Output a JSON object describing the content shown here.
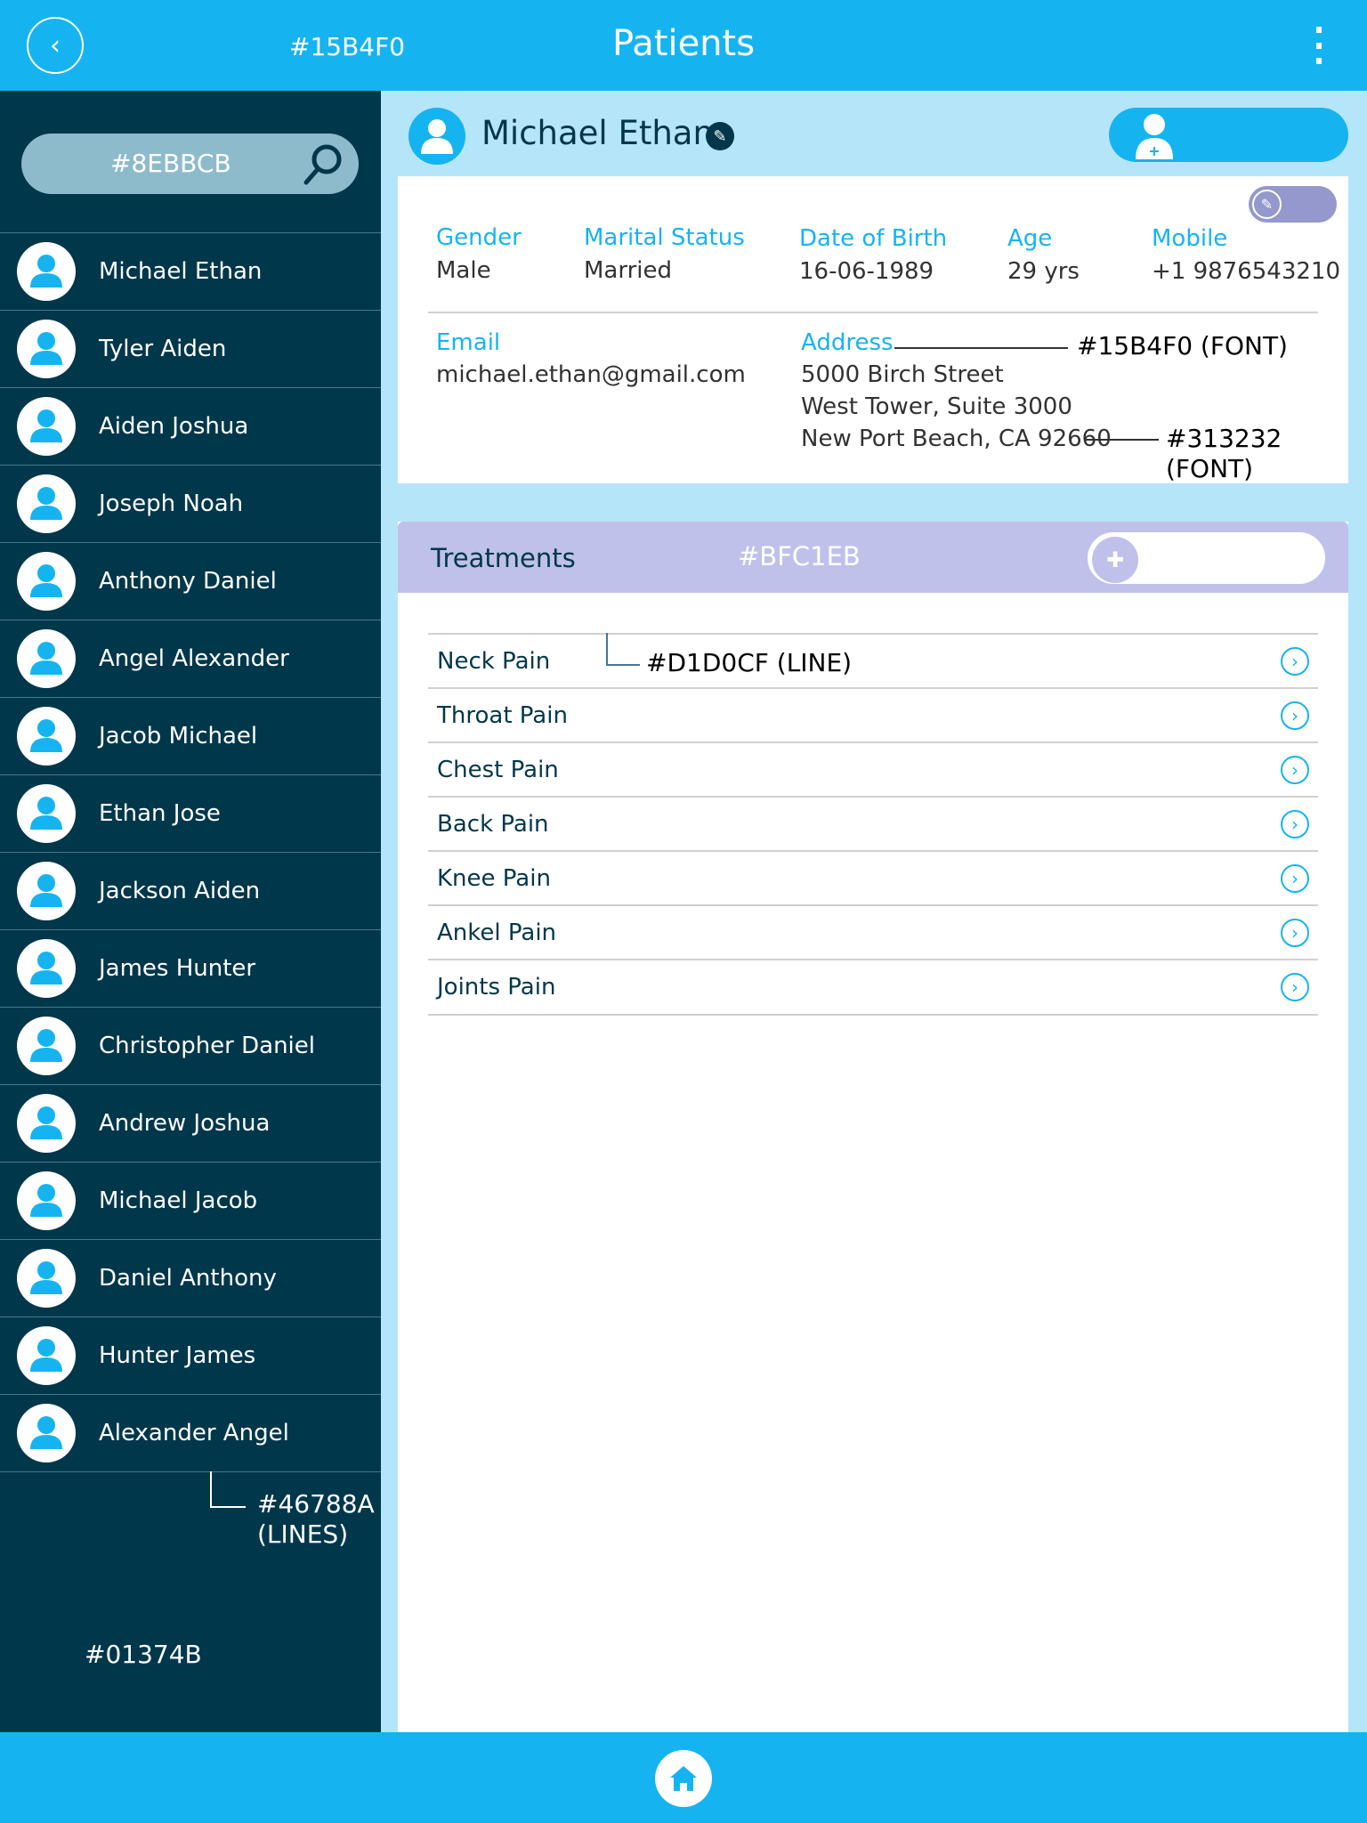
{
  "header": {
    "title": "Patients",
    "color_note": "#15B4F0",
    "back_icon": "chevron-left-icon",
    "menu_icon": "more-vertical-icon"
  },
  "sidebar": {
    "search": {
      "placeholder": "#8EBBCB",
      "icon": "search-icon"
    },
    "patients": [
      "Michael Ethan",
      "Tyler Aiden",
      "Aiden Joshua",
      "Joseph Noah",
      "Anthony Daniel",
      "Angel Alexander",
      "Jacob Michael",
      "Ethan Jose",
      "Jackson Aiden",
      "James Hunter",
      "Christopher Daniel",
      "Andrew Joshua",
      "Michael Jacob",
      "Daniel Anthony",
      "Hunter James",
      "Alexander Angel"
    ],
    "line_note": "#46788A (LINES)",
    "bg_note": "#01374B"
  },
  "patient": {
    "name": "Michael Ethan",
    "fields": [
      {
        "label": "Gender",
        "value": "Male"
      },
      {
        "label": "Marital Status",
        "value": "Married"
      },
      {
        "label": "Date of Birth",
        "value": "16-06-1989"
      },
      {
        "label": "Age",
        "value": "29 yrs"
      },
      {
        "label": "Mobile",
        "value": "+1 9876543210"
      }
    ],
    "email": {
      "label": "Email",
      "value": "michael.ethan@gmail.com"
    },
    "address": {
      "label": "Address",
      "lines": [
        "5000 Birch Street",
        "West Tower, Suite 3000",
        "New Port Beach, CA 92660"
      ]
    },
    "notes": {
      "label_font": "#15B4F0 (FONT)",
      "value_font": "#313232 (FONT)"
    }
  },
  "treatments": {
    "title": "Treatments",
    "header_note": "#BFC1EB",
    "line_note": "#D1D0CF (LINE)",
    "items": [
      "Neck Pain",
      "Throat Pain",
      "Chest Pain",
      "Back Pain",
      "Knee Pain",
      "Ankel Pain",
      "Joints Pain"
    ]
  },
  "colors": {
    "primary": "#15B4F0",
    "sidebar": "#01374B",
    "search": "#8EBBCB",
    "lines": "#46788A",
    "treatments_header": "#BFC1EB",
    "list_line": "#D1D0CF",
    "text": "#313232"
  }
}
